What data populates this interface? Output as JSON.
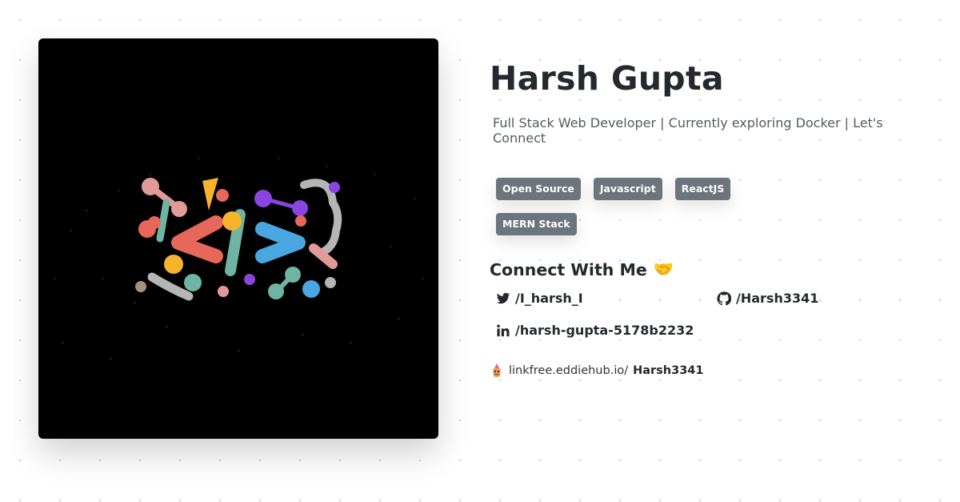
{
  "profile": {
    "name": "Harsh Gupta",
    "bio": "Full Stack Web Developer | Currently exploring Docker | Let's Connect",
    "tags": [
      "Open Source",
      "Javascript",
      "ReactJS",
      "MERN Stack"
    ]
  },
  "connect": {
    "title": "Connect With Me",
    "emoji": "🤝",
    "twitter": {
      "icon": "twitter-icon",
      "handle": "/I_harsh_I"
    },
    "github": {
      "icon": "github-icon",
      "handle": "/Harsh3341"
    },
    "linkedin": {
      "icon": "linkedin-icon",
      "handle": "/harsh-gupta-5178b2232"
    }
  },
  "linkfree": {
    "icon": "linkfree-logo-icon",
    "prefix": "linkfree.eddiehub.io/",
    "username": "Harsh3341"
  },
  "colors": {
    "tag_bg": "#6c757d",
    "image_bg": "#000000",
    "heading": "#24292f"
  }
}
